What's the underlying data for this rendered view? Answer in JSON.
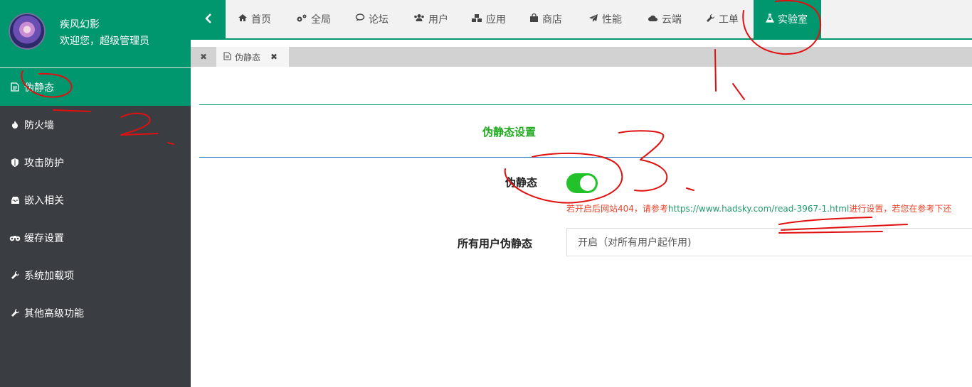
{
  "user": {
    "name": "疾风幻影",
    "welcome": "欢迎您，超级管理员"
  },
  "sidebar": {
    "items": [
      {
        "label": "伪静态",
        "icon": "document-icon",
        "active": true
      },
      {
        "label": "防火墙",
        "icon": "fire-icon"
      },
      {
        "label": "攻击防护",
        "icon": "shield-icon"
      },
      {
        "label": "嵌入相关",
        "icon": "inbox-icon"
      },
      {
        "label": "缓存设置",
        "icon": "binoculars-icon"
      },
      {
        "label": "系统加载项",
        "icon": "wrench-icon"
      },
      {
        "label": "其他高级功能",
        "icon": "wrench-icon"
      }
    ]
  },
  "nav": {
    "toggle_icon": "chevron-left-icon",
    "items": [
      {
        "label": "首页",
        "icon": "home-icon"
      },
      {
        "label": "全局",
        "icon": "gears-icon"
      },
      {
        "label": "论坛",
        "icon": "comment-icon"
      },
      {
        "label": "用户",
        "icon": "users-icon"
      },
      {
        "label": "应用",
        "icon": "cubes-icon"
      },
      {
        "label": "商店",
        "icon": "shopping-bag-icon"
      },
      {
        "label": "性能",
        "icon": "paper-plane-icon"
      },
      {
        "label": "云端",
        "icon": "cloud-icon"
      },
      {
        "label": "工单",
        "icon": "wrench-icon"
      },
      {
        "label": "实验室",
        "icon": "flask-icon",
        "active": true
      }
    ]
  },
  "tabs": {
    "items": [
      {
        "label": "伪静态"
      }
    ]
  },
  "main": {
    "section_title": "伪静态设置",
    "pseudo_static_label": "伪静态",
    "pseudo_static_enabled": true,
    "note_prefix": "若开启后网站404，请参考",
    "note_url": "https://www.hadsky.com/read-3967-1.html",
    "note_suffix": "进行设置，若您在参考下还",
    "all_users_label": "所有用户伪静态",
    "all_users_value": "开启（对所有用户起作用)"
  },
  "colors": {
    "primary": "#00966e",
    "sidebar_bg": "#3a3e43",
    "title_green": "#22aa22",
    "note_red": "#e8452b",
    "toggle_on": "#23c22a",
    "annotation_red": "#e01010"
  }
}
